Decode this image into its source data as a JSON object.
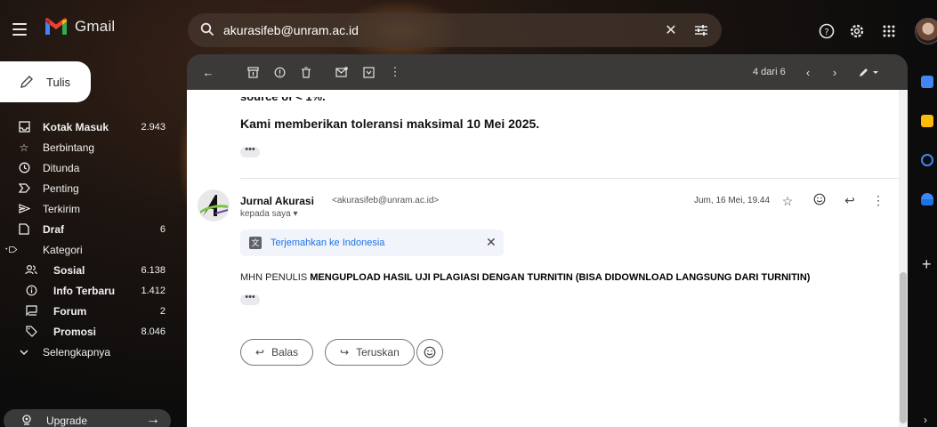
{
  "app": {
    "name": "Gmail"
  },
  "search": {
    "query": "akurasifeb@unram.ac.id"
  },
  "sidebar": {
    "compose_label": "Tulis",
    "items": [
      {
        "label": "Kotak Masuk",
        "count": "2.943"
      },
      {
        "label": "Berbintang",
        "count": ""
      },
      {
        "label": "Ditunda",
        "count": ""
      },
      {
        "label": "Penting",
        "count": ""
      },
      {
        "label": "Terkirim",
        "count": ""
      },
      {
        "label": "Draf",
        "count": "6"
      },
      {
        "label": "Kategori",
        "count": ""
      },
      {
        "label": "Sosial",
        "count": "6.138"
      },
      {
        "label": "Info Terbaru",
        "count": "1.412"
      },
      {
        "label": "Forum",
        "count": "2"
      },
      {
        "label": "Promosi",
        "count": "8.046"
      },
      {
        "label": "Selengkapnya",
        "count": ""
      }
    ],
    "upgrade_label": "Upgrade"
  },
  "toolbar": {
    "pager": "4 dari 6"
  },
  "email": {
    "cutoff_text": "source of < 1%.",
    "tolerance_text": "Kami memberikan toleransi maksimal 10 Mei 2025.",
    "ellipsis": "•••",
    "sender_name": "Jurnal Akurasi",
    "sender_email": "<akurasifeb@unram.ac.id>",
    "recipient": "kepada saya ▾",
    "date": "Jum, 16 Mei, 19.44",
    "translate_label": "Terjemahkan ke Indonesia",
    "message_prefix": "MHN PENULIS",
    "message_bold": "MENGUPLOAD HASIL UJI PLAGIASI DENGAN TURNITIN (BISA DIDOWNLOAD LANGSUNG DARI TURNITIN)",
    "reply_label": "Balas",
    "forward_label": "Teruskan"
  },
  "colors": {
    "accent_blue": "#1a73e8",
    "gmail_red": "#ea4335"
  },
  "icons": {
    "menu": "hamburger-icon",
    "search": "search-icon",
    "clear": "close-icon",
    "filter": "tune-icon",
    "help": "help-icon",
    "settings": "gear-icon",
    "apps": "apps-grid-icon"
  }
}
